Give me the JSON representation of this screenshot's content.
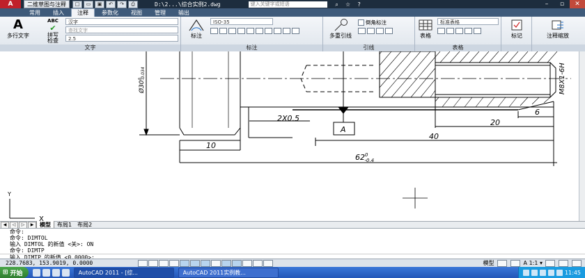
{
  "titlebar": {
    "app_logo": "A",
    "workspace": "二维草图与注释",
    "file_name": "D:\\2...\\综合实例2.dwg",
    "search_placeholder": "键入关键字或短语"
  },
  "ribbon_tabs": [
    "常用",
    "插入",
    "注释",
    "参数化",
    "视图",
    "管理",
    "输出"
  ],
  "active_tab": "注释",
  "panels": {
    "text": {
      "title": "文字",
      "multiline_label": "多行文字",
      "spell_label": "拼写\n检查",
      "spell_top": "ABC",
      "style_value": "汉字",
      "find_placeholder": "查找文字",
      "height_value": "2.5"
    },
    "dim": {
      "title": "标注",
      "dimension_label": "标注",
      "style_value": "ISO-35"
    },
    "leader": {
      "title": "引线",
      "multileader_label": "多重引线",
      "style_value": "倒角标注"
    },
    "table": {
      "title": "表格",
      "table_label": "表格",
      "style_value": "标准表格"
    },
    "markup": {
      "label": "标记"
    },
    "scale": {
      "label": "注释缩放"
    }
  },
  "drawing": {
    "dim_diameter": "Ø30",
    "dim_diameter_tol": "0",
    "dim_diameter_tol2": "-0.034",
    "dim_chamfer": "2X0.5",
    "datum": "A",
    "dim_10": "10",
    "dim_40": "40",
    "dim_20": "20",
    "dim_6": "6",
    "dim_62": "62",
    "dim_62_tol_up": "0",
    "dim_62_tol_dn": "-0.4",
    "thread": "M8X1-6H",
    "ucs_y": "Y",
    "ucs_x": "X"
  },
  "layout_tabs": [
    "模型",
    "布局1",
    "布局2"
  ],
  "active_layout": "模型",
  "command_lines": [
    "命令:",
    "命令: DIMTOL",
    "输入 DIMTOL 的新值 <关>: ON",
    "命令: DIMTP"
  ],
  "command_prompt": "输入 DIMTP 的新值 <0.0000>:",
  "status": {
    "coords": "228.7683, 153.9019, 0.0000",
    "model_label": "模型",
    "scale": "1:1",
    "time": "11:45"
  },
  "taskbar": {
    "start_label": "开始",
    "tasks": [
      "AutoCAD 2011 - [综...",
      "AutoCAD 2011实例教..."
    ]
  },
  "colors": {
    "titlebar": "#1d2d3e",
    "ribbon_tabs": "#3e5a7a",
    "taskbar": "#2457b8",
    "accent_red": "#c0202a"
  }
}
